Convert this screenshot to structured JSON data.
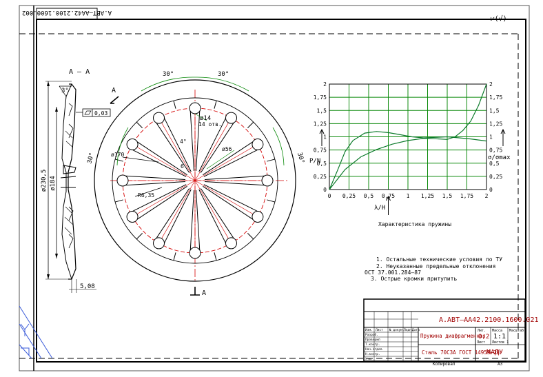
{
  "sheet": {
    "rotated_stamp": "А.АВТ–АА42.2100.1600.002",
    "roughness_mark": "⩗(√)"
  },
  "section": {
    "title": "А – А",
    "dims": {
      "d230": "ø230,5",
      "d184": "ø184",
      "angle": "3°",
      "flatness": "0,03",
      "thickness": "5,08"
    }
  },
  "view": {
    "section_letter_top": "А",
    "section_letter_bottom": "А",
    "angle_left": "30°",
    "angle_right": "30°",
    "angle_side_left": "30°",
    "angle_side_right": "30°",
    "hole_dim": "ø14",
    "hole_count": "14 отв.",
    "slot_angle": "4°",
    "slot_width": "6",
    "circle_dim": "ø170",
    "r56": "ø56",
    "r_small": "R6,35"
  },
  "chart_data": {
    "type": "line",
    "title": "Характеристика пружины",
    "xlabel": "λ/Н",
    "ylabel_left": "Р/N",
    "ylabel_right": "σ/σmax",
    "x_ticks": [
      "0",
      "0,25",
      "0,5",
      "0,75",
      "1",
      "1,25",
      "1,5",
      "1,75",
      "2"
    ],
    "y_ticks": [
      "0",
      "0,25",
      "0,5",
      "0,75",
      "1",
      "1,25",
      "1,5",
      "1,75",
      "2"
    ],
    "xlim": [
      0,
      2
    ],
    "ylim": [
      0,
      2
    ],
    "grid": true,
    "series": [
      {
        "x": [
          0,
          0.1,
          0.2,
          0.3,
          0.45,
          0.6,
          0.75,
          0.9,
          1.05,
          1.2,
          1.35,
          1.5,
          1.65,
          1.8,
          2.0
        ],
        "y": [
          0,
          0.35,
          0.72,
          0.93,
          1.07,
          1.1,
          1.08,
          1.04,
          1.0,
          0.98,
          0.99,
          1.0,
          0.98,
          0.96,
          0.92
        ]
      },
      {
        "x": [
          0,
          0.2,
          0.4,
          0.6,
          0.8,
          1.0,
          1.2,
          1.4,
          1.5,
          1.6,
          1.7,
          1.8,
          1.9,
          2.0
        ],
        "y": [
          0,
          0.38,
          0.62,
          0.76,
          0.86,
          0.93,
          0.97,
          0.96,
          0.95,
          1.0,
          1.12,
          1.3,
          1.6,
          2.0
        ]
      }
    ]
  },
  "notes": [
    "1. Остальные технические условия по ТУ",
    "2. Неуказанные предельные отклонения",
    "ОСТ 37.001.284–87",
    "3. Острые кромки притупить"
  ],
  "title_block": {
    "designation": "А.АВТ–АА42.2100.1600.021",
    "name": "Пружина диафрагменная",
    "material": "Сталь 70С3А ГОСТ 14959–79",
    "org": "МАДУ",
    "scale": "1:1",
    "mass": "0,2",
    "copied_label": "Копировал",
    "format_label": "А3",
    "roles": [
      "Разраб.",
      "Проверил",
      "Т.контр.",
      "Нач.отдел.",
      "Н.контр.",
      "Утв."
    ],
    "header_labels": [
      "Изм.",
      "Лист",
      "№ докум.",
      "Подп.",
      "Дата"
    ],
    "lit_label": "Лит.",
    "mass_label": "Масса",
    "scale_label": "Масштаб",
    "sheet_label": "Лист",
    "sheets_label": "Листов 1"
  }
}
